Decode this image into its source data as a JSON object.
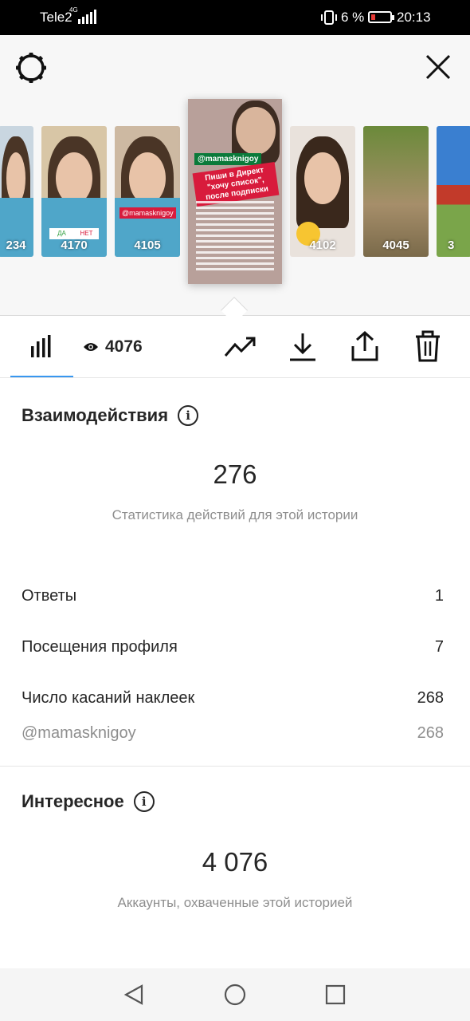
{
  "status_bar": {
    "carrier": "Tele2",
    "network": "4G",
    "battery_percent": "6 %",
    "time": "20:13"
  },
  "story_strip": {
    "thumbnails": [
      {
        "views": "234"
      },
      {
        "views": "4170",
        "poll_yes": "ДА",
        "poll_no": "НЕТ"
      },
      {
        "views": "4105",
        "tag": "@mamasknigoy"
      },
      {
        "views": "4102"
      },
      {
        "views": "4045"
      },
      {
        "views": "3"
      }
    ],
    "selected": {
      "handle": "@mamasknigoy",
      "headline": "Пиши в Директ \"хочу список\", после подписки"
    }
  },
  "toolbar": {
    "views": "4076"
  },
  "interactions": {
    "title": "Взаимодействия",
    "total": "276",
    "subtitle": "Статистика действий для этой истории",
    "rows": [
      {
        "label": "Ответы",
        "value": "1"
      },
      {
        "label": "Посещения профиля",
        "value": "7"
      },
      {
        "label": "Число касаний наклеек",
        "value": "268"
      }
    ],
    "sub_row": {
      "label": "@mamasknigoy",
      "value": "268"
    }
  },
  "discovery": {
    "title": "Интересное",
    "total": "4 076",
    "subtitle": "Аккаунты, охваченные этой историей"
  },
  "colors": {
    "accent": "#3897f0",
    "text": "#262626",
    "muted": "#8e8e8e"
  }
}
